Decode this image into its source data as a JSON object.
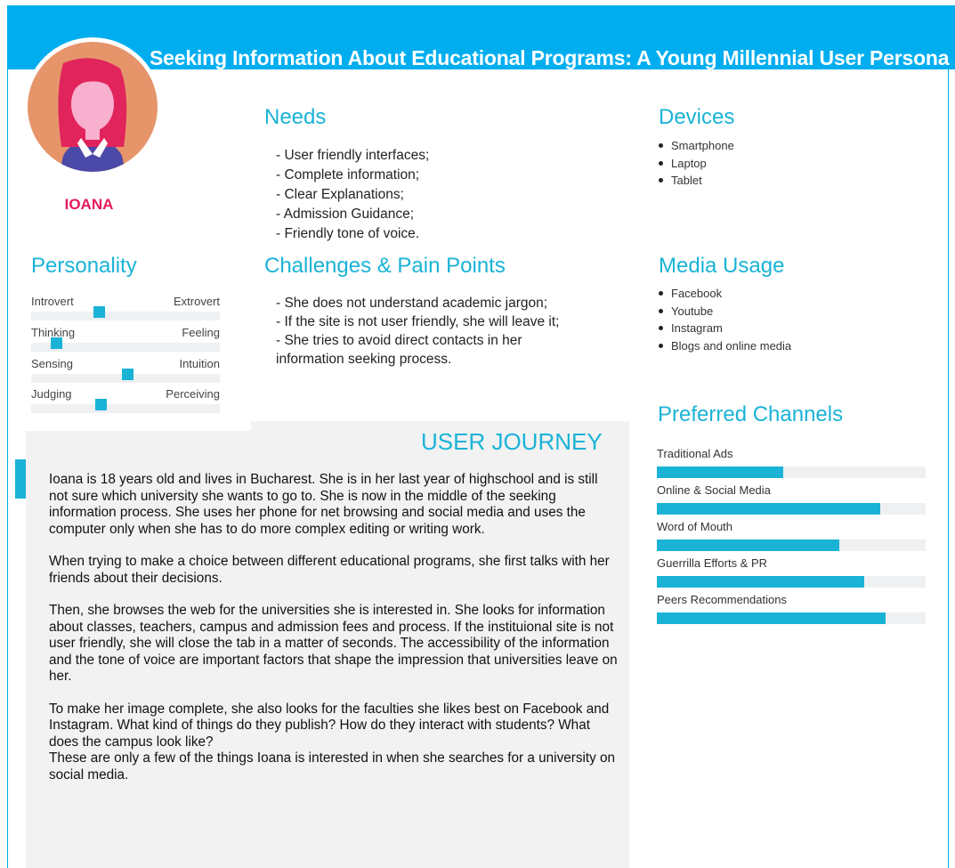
{
  "title": "Seeking Information About Educational Programs: A Young Millennial User Persona",
  "persona": {
    "name": "IOANA"
  },
  "needs": {
    "heading": "Needs",
    "items": [
      "- User friendly interfaces;",
      "- Complete information;",
      "- Clear Explanations;",
      "- Admission Guidance;",
      "- Friendly tone of voice."
    ]
  },
  "devices": {
    "heading": "Devices",
    "items": [
      "Smartphone",
      "Laptop",
      "Tablet"
    ]
  },
  "personality": {
    "heading": "Personality",
    "traits": [
      {
        "left": "Introvert",
        "right": "Extrovert",
        "value": 0.36
      },
      {
        "left": "Thinking",
        "right": "Feeling",
        "value": 0.13
      },
      {
        "left": "Sensing",
        "right": "Intuition",
        "value": 0.51
      },
      {
        "left": "Judging",
        "right": "Perceiving",
        "value": 0.37
      }
    ]
  },
  "challenges": {
    "heading": "Challenges & Pain Points",
    "items": [
      "- She does not understand academic jargon;",
      "- If the site is not user friendly, she will leave it;",
      "- She tries to avoid direct contacts in her",
      "information seeking process."
    ]
  },
  "media_usage": {
    "heading": "Media Usage",
    "items": [
      "Facebook",
      "Youtube",
      "Instagram",
      "Blogs and online media"
    ]
  },
  "user_journey": {
    "heading": "USER JOURNEY",
    "paragraphs": [
      "Ioana is 18 years old and lives in Bucharest. She is in her last year of highschool and is still not sure which university she wants to go to. She is now in the middle of the seeking information process. She uses her phone for net browsing and social media and uses the computer only when she has to do more complex editing or writing work.",
      "When trying to make a choice between different educational programs, she first talks with her friends about their decisions.",
      "Then, she browses the web for the universities she is interested in. She looks for information about classes, teachers, campus and admission fees and process. If the instituional site is not user friendly, she will close the tab in a matter of seconds. The accessibility of the information and the tone of voice are important factors that shape the impression that universities leave on her.",
      "To make her image complete, she also looks for the faculties she likes best on Facebook and Instagram. What kind of things do they publish? How do they interact with students? What does the campus look like?",
      "These are only a few of the things Ioana is interested in when she searches for a university on social media."
    ]
  },
  "preferred_channels": {
    "heading": "Preferred Channels",
    "channels": [
      {
        "label": "Traditional Ads",
        "value": 0.47
      },
      {
        "label": "Online & Social Media",
        "value": 0.83
      },
      {
        "label": "Word of Mouth",
        "value": 0.68
      },
      {
        "label": "Guerrilla Efforts & PR",
        "value": 0.77
      },
      {
        "label": "Peers Recommendations",
        "value": 0.85
      }
    ]
  },
  "colors": {
    "header": "#00aeef",
    "accent": "#1ab3d6",
    "name": "#e41b5b",
    "avatar_bg": "#e6956b",
    "panel_bg": "#f2f2f2"
  }
}
